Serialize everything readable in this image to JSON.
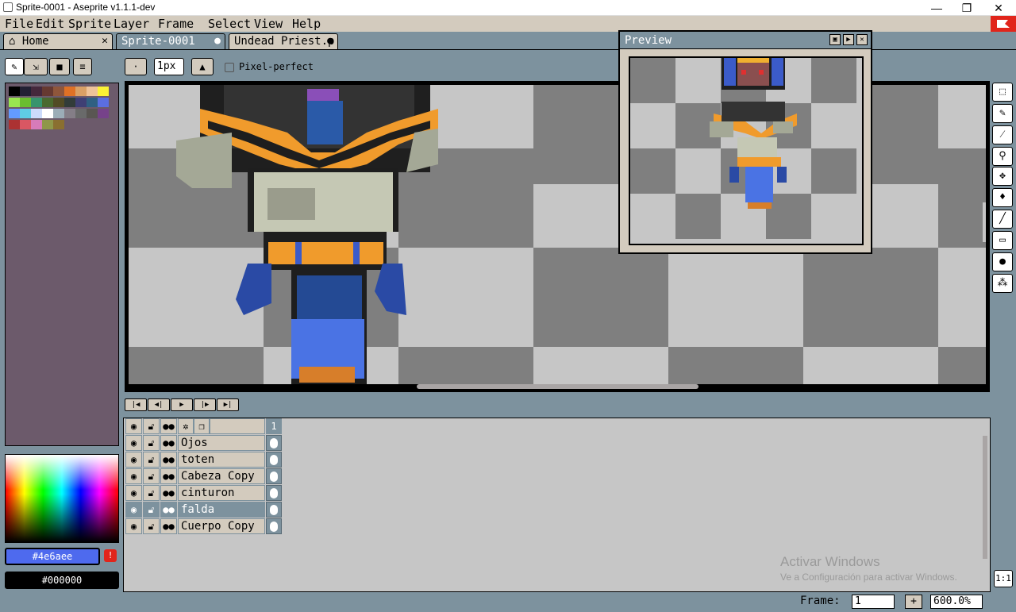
{
  "window": {
    "title": "Sprite-0001 - Aseprite v1.1.1-dev",
    "minimize": "—",
    "maximize": "❐",
    "close": "✕"
  },
  "menu": [
    "File",
    "Edit",
    "Sprite",
    "Layer",
    "Frame",
    "Select",
    "View",
    "Help"
  ],
  "tabs": [
    {
      "label": "Home",
      "icon": "home-icon",
      "close": "✕"
    },
    {
      "label": "Sprite-0001",
      "close": "●"
    },
    {
      "label": "Undead Priest.p",
      "close": "●"
    }
  ],
  "toolbar": {
    "brush_size": "1px",
    "pixel_perfect": "Pixel-perfect"
  },
  "palette": [
    "#000000",
    "#222034",
    "#45283c",
    "#663931",
    "#8f563b",
    "#df7126",
    "#d9a066",
    "#eec39a",
    "#fbf236",
    "#99e550",
    "#6abe30",
    "#37946e",
    "#4b692f",
    "#524b24",
    "#323c39",
    "#3f3f74",
    "#306082",
    "#5b6ee1",
    "#639bff",
    "#5fcde4",
    "#cbdbfc",
    "#ffffff",
    "#9badb7",
    "#847e87",
    "#696a6a",
    "#595652",
    "#76428a",
    "#ac3232",
    "#d95763",
    "#d77bba",
    "#8f974a",
    "#8a6f30"
  ],
  "colors": {
    "foreground": "#4e6aee",
    "background": "#000000",
    "foreground_swatch": "#4e6aee",
    "background_swatch": "#000000"
  },
  "preview": {
    "title": "Preview"
  },
  "timeline_buttons": [
    "first-frame",
    "prev-frame",
    "play",
    "next-frame",
    "last-frame"
  ],
  "layers": {
    "frame_header": "1",
    "items": [
      {
        "name": "Ojos",
        "selected": false
      },
      {
        "name": "toten",
        "selected": false
      },
      {
        "name": "Cabeza Copy",
        "selected": false
      },
      {
        "name": "cinturon",
        "selected": false
      },
      {
        "name": "falda",
        "selected": true
      },
      {
        "name": "Cuerpo Copy",
        "selected": false
      }
    ]
  },
  "watermark": {
    "line1": "Activar Windows",
    "line2": "Ve a Configuración para activar Windows."
  },
  "status": {
    "frame_label": "Frame:",
    "frame_value": "1",
    "add_button": "+",
    "zoom": "600.0%",
    "zoom_reset": "1:1"
  }
}
